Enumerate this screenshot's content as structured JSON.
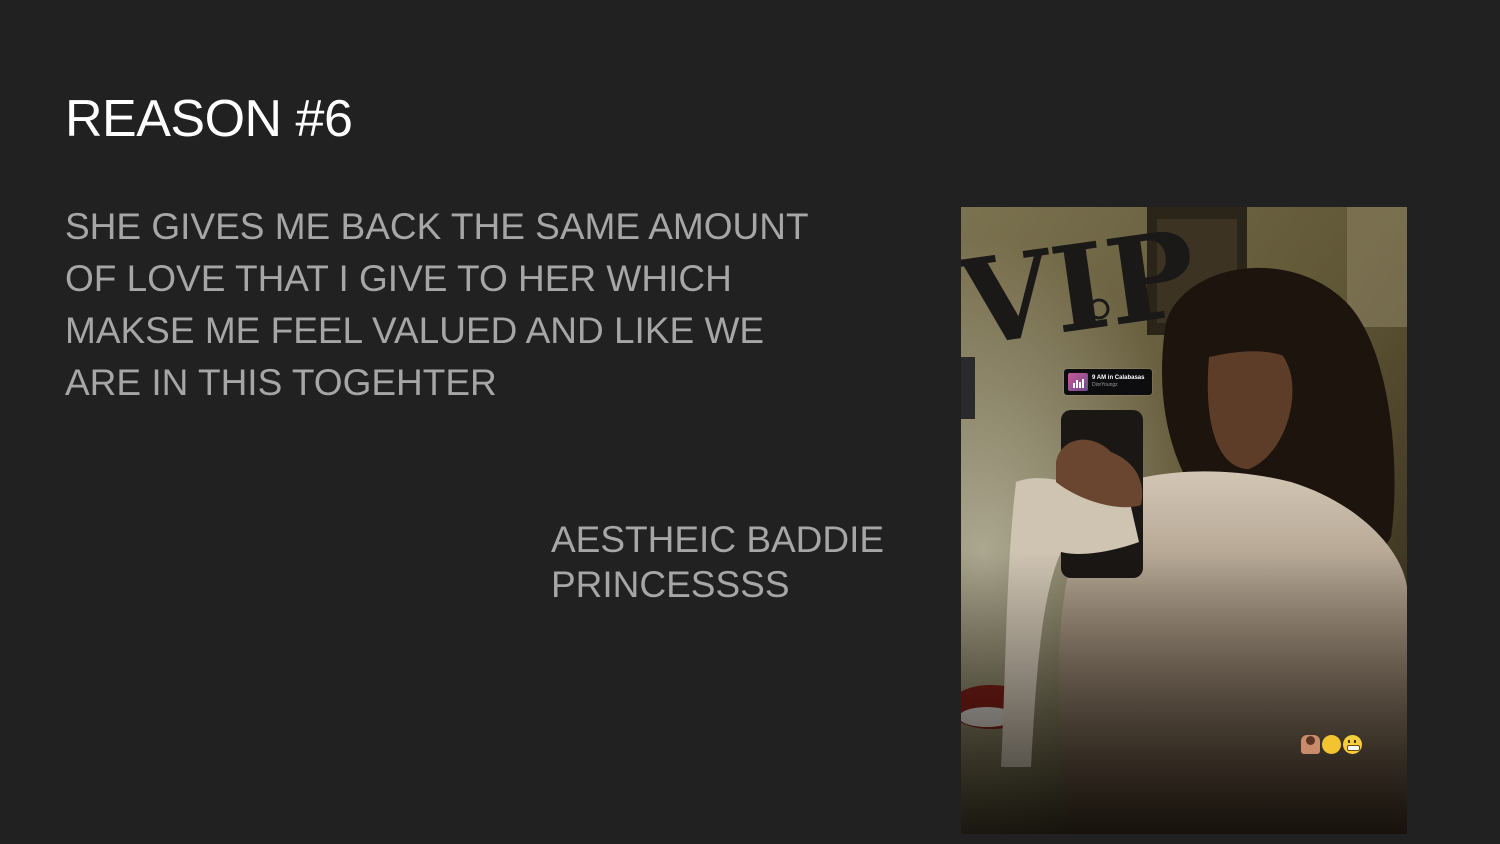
{
  "slide": {
    "title": "REASON #6",
    "body_lines": [
      "SHE GIVES ME BACK THE SAME AMOUNT",
      "OF LOVE THAT I GIVE TO HER WHICH",
      "MAKSE ME FEEL VALUED AND LIKE WE",
      "ARE IN THIS TOGEHTER"
    ],
    "caption_lines": [
      "AESTHEIC BADDIE",
      "PRINCESSSS"
    ]
  },
  "photo": {
    "wall_text": "VIP",
    "music_sticker": {
      "title": "9 AM in Calabasas",
      "artist": "DiorYoungz"
    },
    "emoji_sticker": [
      "person-shrugging-icon",
      "hugging-face-icon",
      "grimacing-face-icon"
    ]
  },
  "colors": {
    "background": "#212121",
    "title": "#ffffff",
    "body_text": "#a6a6a6"
  }
}
